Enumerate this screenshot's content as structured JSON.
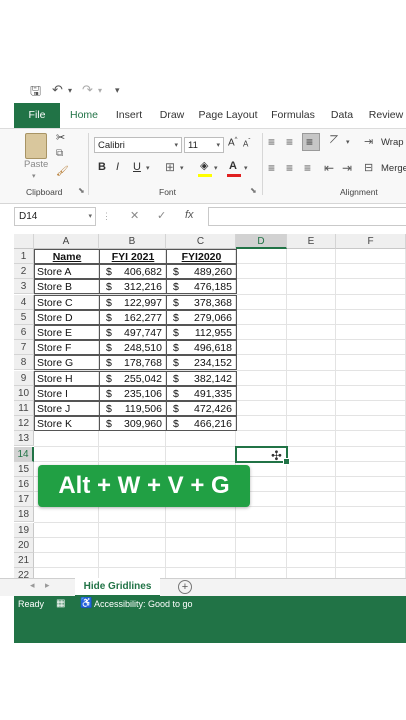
{
  "quick_access": {
    "save_icon": "save-icon",
    "undo_icon": "undo-icon",
    "redo_icon": "redo-icon",
    "customize_icon": "customize-icon"
  },
  "tabs": [
    "File",
    "Home",
    "Insert",
    "Draw",
    "Page Layout",
    "Formulas",
    "Data",
    "Review"
  ],
  "ribbon": {
    "clipboard": {
      "paste_label": "Paste",
      "group_label": "Clipboard"
    },
    "font": {
      "font_name": "Calibri",
      "font_size": "11",
      "bold": "B",
      "italic": "I",
      "underline": "U",
      "font_color_letter": "A",
      "group_label": "Font"
    },
    "alignment": {
      "wrap_label": "Wrap",
      "merge_label": "Merge",
      "group_label": "Alignment"
    }
  },
  "formula_bar": {
    "name_box": "D14",
    "cancel": "✕",
    "enter": "✓",
    "fx": "fx",
    "value": ""
  },
  "columns": [
    "A",
    "B",
    "C",
    "D",
    "E",
    "F"
  ],
  "rows": [
    "1",
    "2",
    "3",
    "4",
    "5",
    "6",
    "7",
    "8",
    "9",
    "10",
    "11",
    "12",
    "13",
    "14",
    "15",
    "16",
    "17",
    "18",
    "19",
    "20",
    "21",
    "22"
  ],
  "table": {
    "headers": [
      "Name",
      "FYI 2021",
      "FYI2020"
    ],
    "currency": "$",
    "rows": [
      {
        "name": "Store A",
        "fy2021": "406,682",
        "fy2020": "489,260"
      },
      {
        "name": "Store B",
        "fy2021": "312,216",
        "fy2020": "476,185"
      },
      {
        "name": "Store C",
        "fy2021": "122,997",
        "fy2020": "378,368"
      },
      {
        "name": "Store D",
        "fy2021": "162,277",
        "fy2020": "279,066"
      },
      {
        "name": "Store E",
        "fy2021": "497,747",
        "fy2020": "112,955"
      },
      {
        "name": "Store F",
        "fy2021": "248,510",
        "fy2020": "496,618"
      },
      {
        "name": "Store G",
        "fy2021": "178,768",
        "fy2020": "234,152"
      },
      {
        "name": "Store H",
        "fy2021": "255,042",
        "fy2020": "382,142"
      },
      {
        "name": "Store I",
        "fy2021": "235,106",
        "fy2020": "491,335"
      },
      {
        "name": "Store J",
        "fy2021": "119,506",
        "fy2020": "472,426"
      },
      {
        "name": "Store K",
        "fy2021": "309,960",
        "fy2020": "466,216"
      }
    ]
  },
  "shortcut_banner": "Alt + W + V + G",
  "sheet_tabs": {
    "active": "Hide Gridlines",
    "add": "+"
  },
  "status": {
    "ready": "Ready",
    "accessibility": "Accessibility: Good to go"
  },
  "colors": {
    "accent": "#217346",
    "banner": "#21a044"
  }
}
